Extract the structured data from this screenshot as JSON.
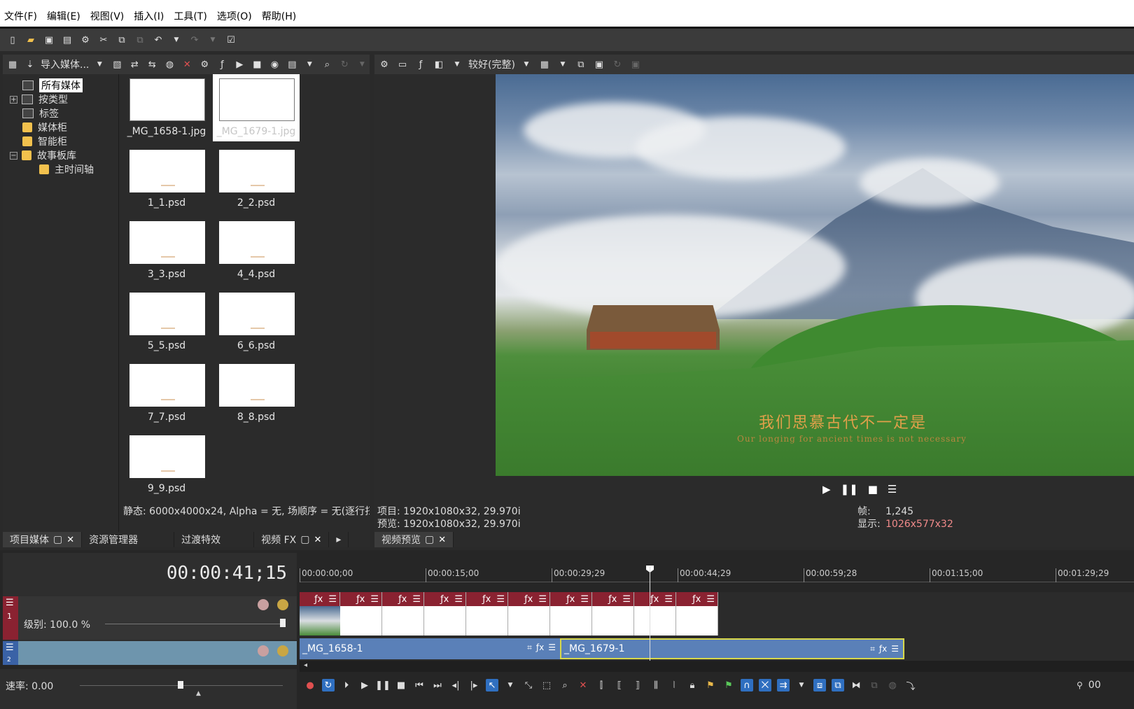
{
  "menubar": {
    "items": [
      "文件(F)",
      "编辑(E)",
      "视图(V)",
      "插入(I)",
      "工具(T)",
      "选项(O)",
      "帮助(H)"
    ]
  },
  "media_panel": {
    "toolbar_import_label": "导入媒体...",
    "tree": {
      "all_media": "所有媒体",
      "by_type": "按类型",
      "tags": "标签",
      "media_bins": "媒体柜",
      "smart_bins": "智能柜",
      "storyboard": "故事板库",
      "main_timeline": "主时间轴"
    },
    "thumbnails": [
      {
        "name": "_MG_1658-1.jpg",
        "kind": "photo",
        "selected": false
      },
      {
        "name": "_MG_1679-1.jpg",
        "kind": "photo",
        "selected": true
      },
      {
        "name": "1_1.psd",
        "kind": "psd"
      },
      {
        "name": "2_2.psd",
        "kind": "psd"
      },
      {
        "name": "3_3.psd",
        "kind": "psd"
      },
      {
        "name": "4_4.psd",
        "kind": "psd"
      },
      {
        "name": "5_5.psd",
        "kind": "psd"
      },
      {
        "name": "6_6.psd",
        "kind": "psd"
      },
      {
        "name": "7_7.psd",
        "kind": "psd"
      },
      {
        "name": "8_8.psd",
        "kind": "psd"
      },
      {
        "name": "9_9.psd",
        "kind": "psd"
      }
    ],
    "status": "静态: 6000x4000x24, Alpha = 无, 场顺序 = 无(逐行扫"
  },
  "left_tabs": {
    "project_media": "项目媒体",
    "explorer": "资源管理器",
    "transitions": "过渡特效",
    "video_fx": "视频 FX"
  },
  "preview": {
    "quality": "较好(完整)",
    "overlay_cn": "我们思慕古代不一定是",
    "overlay_en": "Our longing for ancient times is not necessary",
    "project_label": "项目:",
    "project_value": "1920x1080x32, 29.970i",
    "preview_label": "预览:",
    "preview_value": "1920x1080x32, 29.970i",
    "frame_label": "帧:",
    "frame_value": "1,245",
    "display_label": "显示:",
    "display_value": "1026x577x32",
    "tab_label": "视频预览"
  },
  "timeline": {
    "timecode": "00:00:41;15",
    "ruler_ticks": [
      "00:00:00;00",
      "00:00:15;00",
      "00:00:29;29",
      "00:00:44;29",
      "00:00:59;28",
      "00:01:15;00",
      "00:01:29;29"
    ],
    "track1_level": "级别: 100.0 %",
    "track1_number": "1",
    "track2_number": "2",
    "track2_events": [
      {
        "name": "_MG_1658-1"
      },
      {
        "name": "_MG_1679-1"
      }
    ],
    "rate_label": "速率: 0.00",
    "right_edge_value": "00"
  },
  "colors": {
    "video_track": "#8a2231",
    "audio_track": "#3a62a6",
    "selection_highlight": "#2f6fc0",
    "display_value_pink": "#f08a8a"
  }
}
